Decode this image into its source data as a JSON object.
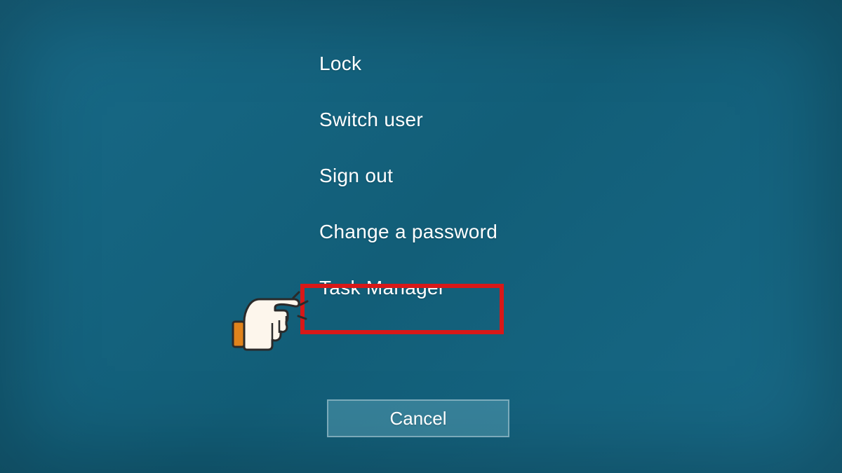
{
  "menu": {
    "items": [
      {
        "label": "Lock",
        "name": "lock-option"
      },
      {
        "label": "Switch user",
        "name": "switch-user-option"
      },
      {
        "label": "Sign out",
        "name": "sign-out-option"
      },
      {
        "label": "Change a password",
        "name": "change-password-option"
      },
      {
        "label": "Task Manager",
        "name": "task-manager-option"
      }
    ]
  },
  "cancel_label": "Cancel",
  "highlighted_index": 4,
  "colors": {
    "background": "#186a88",
    "highlight_border": "#d81818",
    "text": "#ffffff"
  }
}
